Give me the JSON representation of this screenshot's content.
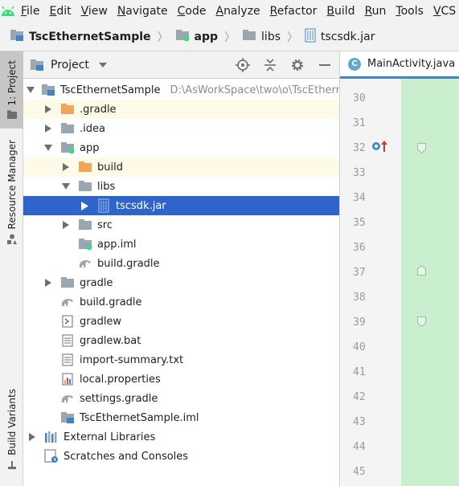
{
  "menubar": {
    "items": [
      "File",
      "Edit",
      "View",
      "Navigate",
      "Code",
      "Analyze",
      "Refactor",
      "Build",
      "Run",
      "Tools",
      "VCS"
    ]
  },
  "breadcrumb": {
    "items": [
      "TscEthernetSample",
      "app",
      "libs",
      "tscsdk.jar"
    ]
  },
  "toolstrip": {
    "project_tab": "1: Project",
    "resource_manager_tab": "Resource Manager",
    "build_variants_tab": "Build Variants"
  },
  "project_panel": {
    "title": "Project"
  },
  "tree": {
    "root": {
      "label": "TscEthernetSample",
      "path": "D:\\AsWorkSpace\\two\\o\\TscEthernet"
    },
    "gradle_hidden": ".gradle",
    "idea": ".idea",
    "app": "app",
    "build": "build",
    "libs": "libs",
    "tscsdk": "tscsdk.jar",
    "src": "src",
    "app_iml": "app.iml",
    "app_build_gradle": "build.gradle",
    "gradle": "gradle",
    "root_build_gradle": "build.gradle",
    "gradlew": "gradlew",
    "gradlew_bat": "gradlew.bat",
    "import_summary": "import-summary.txt",
    "local_properties": "local.properties",
    "settings_gradle": "settings.gradle",
    "root_iml": "TscEthernetSample.iml",
    "external_libraries": "External Libraries",
    "scratches": "Scratches and Consoles"
  },
  "editor": {
    "tab_label": "MainActivity.java",
    "line_numbers": [
      "30",
      "31",
      "32",
      "33",
      "34",
      "35",
      "36",
      "37",
      "38",
      "39",
      "40",
      "41",
      "42",
      "43",
      "44",
      "45"
    ]
  },
  "colors": {
    "selection": "#2f65ca",
    "highlight": "#fdfbe8",
    "folder_orange": "#f2a45a",
    "folder_gray": "#9aa7b0",
    "code_bg": "#c9efcf"
  }
}
